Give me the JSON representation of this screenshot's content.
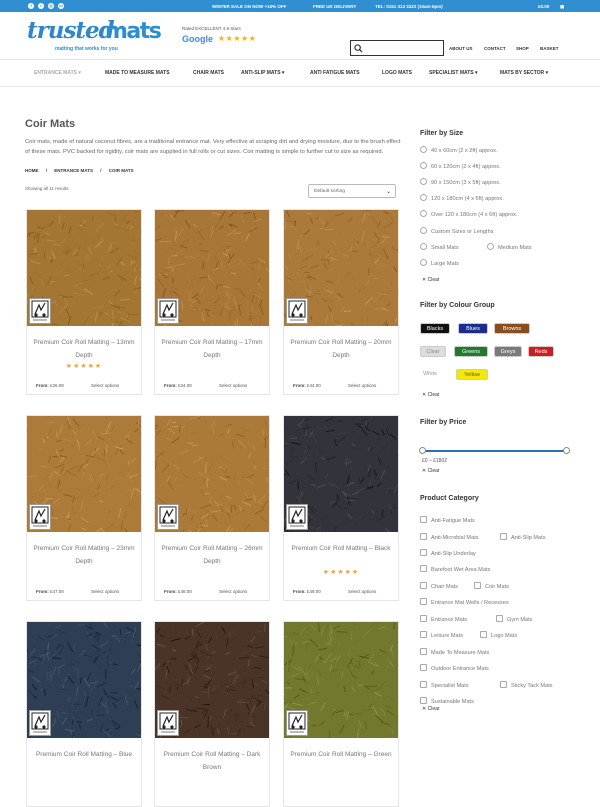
{
  "topbar": {
    "promo1": "WINTER SALE ON NOW +10% OFF",
    "promo2": "FREE UK DELIVERY",
    "phone": "TEL: 0151 313 3322 (10am-5pm)",
    "cart_total": "£0.00"
  },
  "header": {
    "logo_part1": "trusted",
    "logo_part2": "mats",
    "tagline": "matting that works for you",
    "rating_text": "Rated EXCELLENT 4.9 Stars",
    "rating_source": "Google",
    "rating_stars": "★★★★★",
    "search_placeholder": "",
    "nav": [
      "ABOUT US",
      "CONTACT",
      "SHOP",
      "BASKET"
    ]
  },
  "mainnav": [
    "ENTRANCE MATS",
    "MADE TO MEASURE MATS",
    "CHAIR MATS",
    "ANTI-SLIP MATS",
    "ANTI FATIGUE MATS",
    "LOGO MATS",
    "SPECIALIST MATS",
    "MATS BY SECTOR"
  ],
  "page": {
    "title": "Coir Mats",
    "description": "Coir mats, made of natural coconut fibres, are a traditional entrance mat. Very effective at scraping dirt and drying moisture, due to the brush effect of these mats. PVC backed for rigidity, coir mats are supplied in full rolls or cut sizes. Coir matting is simple to further cut to size as required.",
    "breadcrumb": [
      "HOME",
      "ENTRANCE MATS",
      "COIR MATS"
    ],
    "result_count": "Showing all 11 results",
    "sort_label": "Default sorting"
  },
  "products": [
    {
      "name": "Premium Coir Roll Matting – 13mm Depth",
      "price_label": "From:",
      "price": "£26.00",
      "action": "Select options",
      "stars": "★★★★★",
      "color": "#a47634"
    },
    {
      "name": "Premium Coir Roll Matting – 17mm Depth",
      "price_label": "From:",
      "price": "£34.00",
      "action": "Select options",
      "stars": "",
      "color": "#a87738"
    },
    {
      "name": "Premium Coir Roll Matting – 20mm Depth",
      "price_label": "From:",
      "price": "£44.00",
      "action": "Select options",
      "stars": "",
      "color": "#a97a39"
    },
    {
      "name": "Premium Coir Roll Matting – 23mm Depth",
      "price_label": "From:",
      "price": "£47.00",
      "action": "Select options",
      "stars": "",
      "color": "#ad7b39"
    },
    {
      "name": "Premium Coir Roll Matting – 26mm Depth",
      "price_label": "From:",
      "price": "£48.00",
      "action": "Select options",
      "stars": "",
      "color": "#ac7a38"
    },
    {
      "name": "Premium Coir Roll Matting – Black",
      "price_label": "From:",
      "price": "£49.00",
      "action": "Select options",
      "stars": "★★★★★",
      "color": "#33333b"
    },
    {
      "name": "Premium Coir Roll Matting – Blue",
      "price_label": "",
      "price": "",
      "action": "",
      "stars": "",
      "color": "#2e3e55"
    },
    {
      "name": "Premium Coir Roll Matting – Dark Brown",
      "price_label": "",
      "price": "",
      "action": "",
      "stars": "",
      "color": "#4a3428"
    },
    {
      "name": "Premium Coir Roll Matting – Green",
      "price_label": "",
      "price": "",
      "action": "",
      "stars": "",
      "color": "#73782f"
    }
  ],
  "sidebar": {
    "size_title": "Filter by Size",
    "sizes": [
      "40 x 60cm (2 x 2ft) approx.",
      "60 x 120cm (2 x 4ft) approx.",
      "90 x 150cm (3 x 5ft) approx.",
      "120 x 180cm (4 x 6ft) approx.",
      "Over 120 x 180cm (4 x 6ft) approx.",
      "Custom Sizes or Lengths",
      "Small Mats",
      "Medium Mats",
      "Large Mats"
    ],
    "clear": "Clear",
    "colour_title": "Filter by Colour Group",
    "colours": [
      {
        "label": "Blacks",
        "bg": "#111111",
        "fg": "#ffffff"
      },
      {
        "label": "Blues",
        "bg": "#1d2b8c",
        "fg": "#ffffff"
      },
      {
        "label": "Browns",
        "bg": "#8b4d1e",
        "fg": "#ffffff"
      },
      {
        "label": "Clear",
        "bg": "#dddddd",
        "fg": "#888888"
      },
      {
        "label": "Greens",
        "bg": "#1e7a2e",
        "fg": "#ffffff"
      },
      {
        "label": "Greys",
        "bg": "#7a7a7a",
        "fg": "#ffffff"
      },
      {
        "label": "Reds",
        "bg": "#cc1e1e",
        "fg": "#ffffff"
      },
      {
        "label": "White",
        "bg": "#ffffff",
        "fg": "#999999"
      },
      {
        "label": "Yellow",
        "bg": "#f5e900",
        "fg": "#555555"
      }
    ],
    "price_title": "Filter by Price",
    "price_range": "£0 – £1802",
    "category_title": "Product Category",
    "categories": [
      "Anti-Fatigue Mats",
      "Anti-Microbial Mats",
      "Anti-Slip Mats",
      "Anti-Slip Underlay",
      "Barefoot Wet Area Mats",
      "Chair Mats",
      "Coir Mats",
      "Entrance Mat Wells / Recesses",
      "Entrance Mats",
      "Gym Mats",
      "Leisure Mats",
      "Logo Mats",
      "Made To Measure Mats",
      "Outdoor Entrance Mats",
      "Specialist Mats",
      "Sticky Tack Mats",
      "Sustainable Mats"
    ]
  }
}
